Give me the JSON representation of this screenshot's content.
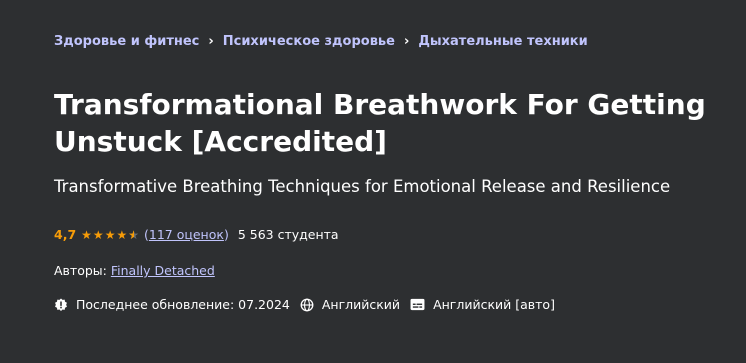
{
  "breadcrumbs": [
    {
      "label": "Здоровье и фитнес"
    },
    {
      "label": "Психическое здоровье"
    },
    {
      "label": "Дыхательные техники"
    }
  ],
  "breadcrumb_separator": "›",
  "course": {
    "title": "Transformational Breathwork For Getting Unstuck [Accredited]",
    "subtitle": "Transformative Breathing Techniques for Emotional Release and Resilience",
    "rating": "4,7",
    "rating_value": 4.7,
    "rating_max": 5,
    "reviews_label": "117 оценок",
    "students_label": "5 563 студента",
    "authors_label": "Авторы:",
    "author_name": "Finally Detached",
    "last_updated": "Последнее обновление: 07.2024",
    "language": "Английский",
    "captions": "Английский [авто]"
  },
  "colors": {
    "background": "#2d2f31",
    "link": "#c0c4fc",
    "star": "#f69c08",
    "text": "#ffffff"
  },
  "icons": {
    "update": "alert-badge-icon",
    "language": "globe-icon",
    "captions": "closed-captions-icon"
  }
}
